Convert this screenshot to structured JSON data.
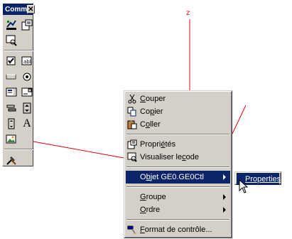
{
  "toolbox": {
    "title": "Comm",
    "close": "✕",
    "tools": [
      {
        "name": "design-mode-icon"
      },
      {
        "name": "properties-icon"
      },
      {
        "name": "view-code-icon"
      },
      {
        "name": "checkbox-icon"
      },
      {
        "name": "textbox-icon"
      },
      {
        "name": "command-button-icon"
      },
      {
        "name": "option-button-icon"
      },
      {
        "name": "list-box-icon"
      },
      {
        "name": "combo-box-icon"
      },
      {
        "name": "toggle-button-icon"
      },
      {
        "name": "spin-button-icon"
      },
      {
        "name": "scroll-bar-icon"
      },
      {
        "name": "label-icon"
      },
      {
        "name": "image-icon"
      },
      {
        "name": "more-controls-icon"
      }
    ],
    "label_glyph": "A"
  },
  "axis": {
    "z_label": "z"
  },
  "context_menu": {
    "cut": {
      "pre": "",
      "u": "C",
      "post": "ouper"
    },
    "copy": {
      "pre": "Co",
      "u": "p",
      "post": "ier"
    },
    "paste": {
      "pre": "C",
      "u": "o",
      "post": "ller"
    },
    "properties": {
      "pre": "Propri",
      "u": "é",
      "post": "tés"
    },
    "view_code": {
      "pre": "Visualiser le ",
      "u": "c",
      "post": "ode"
    },
    "object": {
      "pre": "O",
      "u": "b",
      "post": "jet GE0.GE0Ctl"
    },
    "group": {
      "pre": "",
      "u": "G",
      "post": "roupe"
    },
    "order": {
      "pre": "",
      "u": "O",
      "post": "rdre"
    },
    "format": {
      "pre": "",
      "u": "F",
      "post": "ormat de contrôle..."
    }
  },
  "submenu": {
    "properties": {
      "pre": "",
      "u": "P",
      "post": "roperties"
    }
  },
  "colors": {
    "axis_red": "#e8000b",
    "highlight": "#0a246a",
    "face": "#d4d0c8"
  }
}
